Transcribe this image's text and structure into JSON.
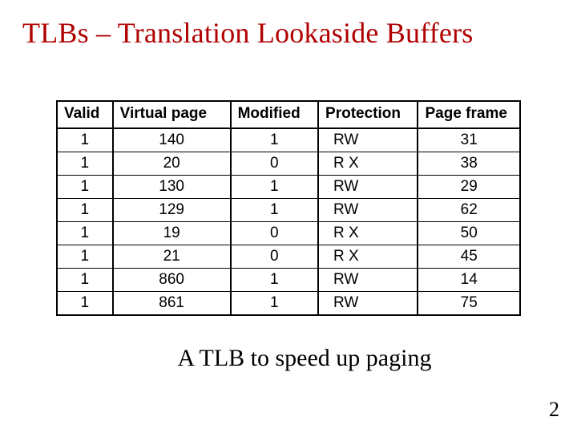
{
  "title": "TLBs – Translation Lookaside Buffers",
  "table": {
    "headers": [
      "Valid",
      "Virtual page",
      "Modified",
      "Protection",
      "Page frame"
    ],
    "rows": [
      {
        "valid": "1",
        "vpage": "140",
        "modified": "1",
        "protection": "RW",
        "frame": "31"
      },
      {
        "valid": "1",
        "vpage": "20",
        "modified": "0",
        "protection": "R X",
        "frame": "38"
      },
      {
        "valid": "1",
        "vpage": "130",
        "modified": "1",
        "protection": "RW",
        "frame": "29"
      },
      {
        "valid": "1",
        "vpage": "129",
        "modified": "1",
        "protection": "RW",
        "frame": "62"
      },
      {
        "valid": "1",
        "vpage": "19",
        "modified": "0",
        "protection": "R X",
        "frame": "50"
      },
      {
        "valid": "1",
        "vpage": "21",
        "modified": "0",
        "protection": "R X",
        "frame": "45"
      },
      {
        "valid": "1",
        "vpage": "860",
        "modified": "1",
        "protection": "RW",
        "frame": "14"
      },
      {
        "valid": "1",
        "vpage": "861",
        "modified": "1",
        "protection": "RW",
        "frame": "75"
      }
    ]
  },
  "caption": "A TLB to speed up paging",
  "page_number": "2",
  "chart_data": {
    "type": "table",
    "title": "TLB entries",
    "columns": [
      "Valid",
      "Virtual page",
      "Modified",
      "Protection",
      "Page frame"
    ],
    "rows": [
      [
        1,
        140,
        1,
        "RW",
        31
      ],
      [
        1,
        20,
        0,
        "R X",
        38
      ],
      [
        1,
        130,
        1,
        "RW",
        29
      ],
      [
        1,
        129,
        1,
        "RW",
        62
      ],
      [
        1,
        19,
        0,
        "R X",
        50
      ],
      [
        1,
        21,
        0,
        "R X",
        45
      ],
      [
        1,
        860,
        1,
        "RW",
        14
      ],
      [
        1,
        861,
        1,
        "RW",
        75
      ]
    ]
  }
}
